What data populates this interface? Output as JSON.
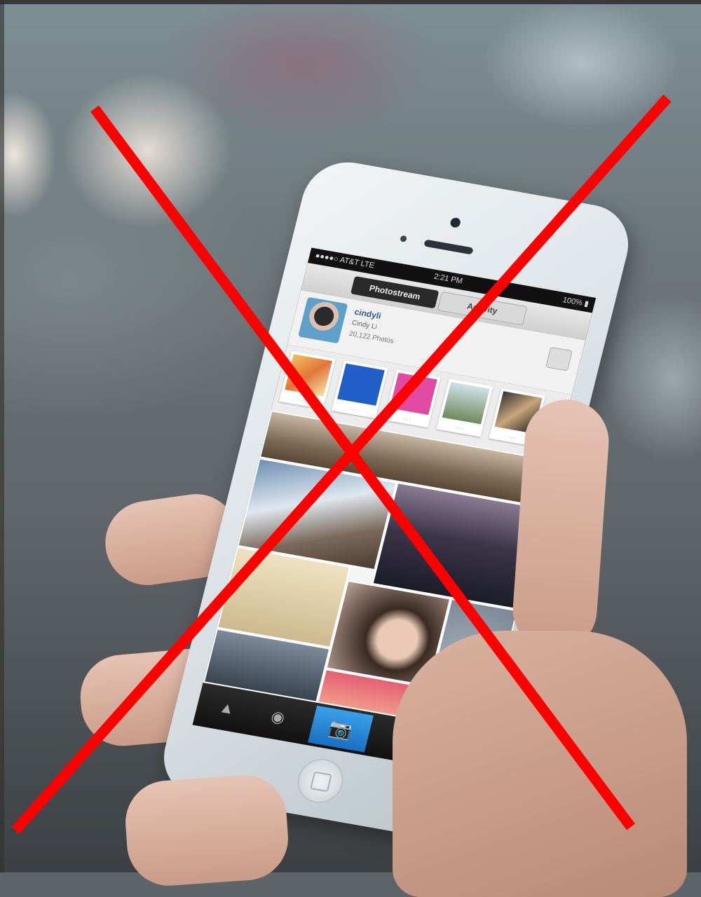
{
  "phone_screen": {
    "tabs": [
      "Photostream",
      "Activity"
    ],
    "profile": {
      "username": "cindyli",
      "subtitle": "Cindy Li",
      "photo_count": "20,122 Photos"
    }
  },
  "overlay": {
    "cross_color": "#ff0000"
  }
}
